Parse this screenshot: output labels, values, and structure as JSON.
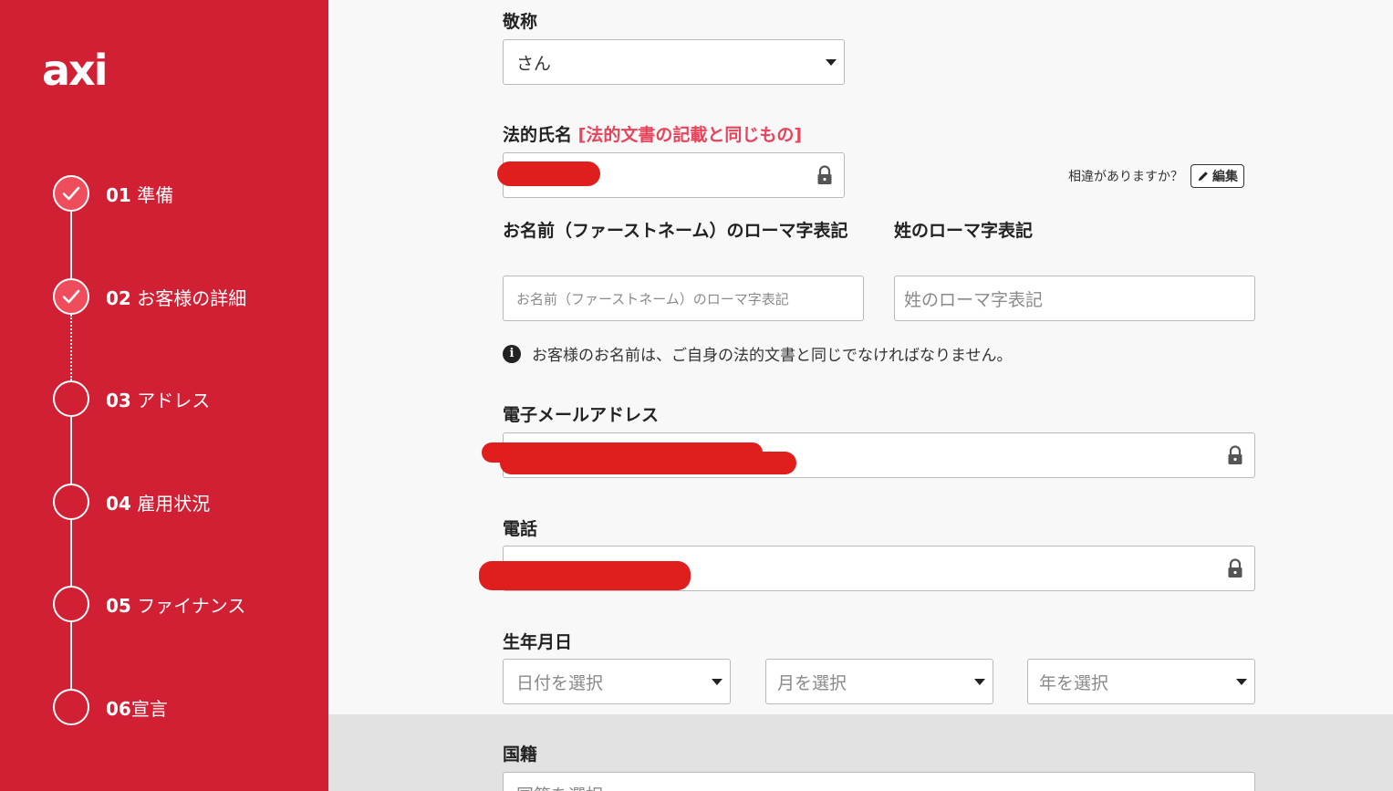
{
  "sidebar": {
    "logo": "axi",
    "steps": [
      {
        "num": "01",
        "label": " 準備",
        "state": "done"
      },
      {
        "num": "02",
        "label": " お客様の詳細",
        "state": "done"
      },
      {
        "num": "03",
        "label": " アドレス",
        "state": "pending"
      },
      {
        "num": "04",
        "label": " 雇用状況",
        "state": "pending"
      },
      {
        "num": "05",
        "label": " ファイナンス",
        "state": "pending"
      },
      {
        "num": "06",
        "label": "宣言",
        "state": "pending"
      }
    ]
  },
  "form": {
    "title_label": "敬称",
    "title_value": "さん",
    "legal_name_label": "法的氏名",
    "legal_name_hint": "[法的文書の記載と同じもの]",
    "mismatch_text": "相違がありますか？",
    "edit_label": "編集",
    "first_name_label": "お名前（ファーストネーム）のローマ字表記",
    "first_name_placeholder": "お名前（ファーストネーム）のローマ字表記",
    "last_name_label": "姓のローマ字表記",
    "last_name_placeholder": "姓のローマ字表記",
    "info_text": "お客様のお名前は、ご自身の法的文書と同じでなければなりません。",
    "email_label": "電子メールアドレス",
    "phone_label": "電話",
    "dob_label": "生年月日",
    "dob_day_placeholder": "日付を選択",
    "dob_month_placeholder": "月を選択",
    "dob_year_placeholder": "年を選択",
    "nationality_label": "国籍",
    "nationality_placeholder": "国籍を選択"
  },
  "colors": {
    "sidebar_bg": "#d11f34",
    "hint_red": "#e8435a",
    "redaction": "#e01e1e"
  }
}
